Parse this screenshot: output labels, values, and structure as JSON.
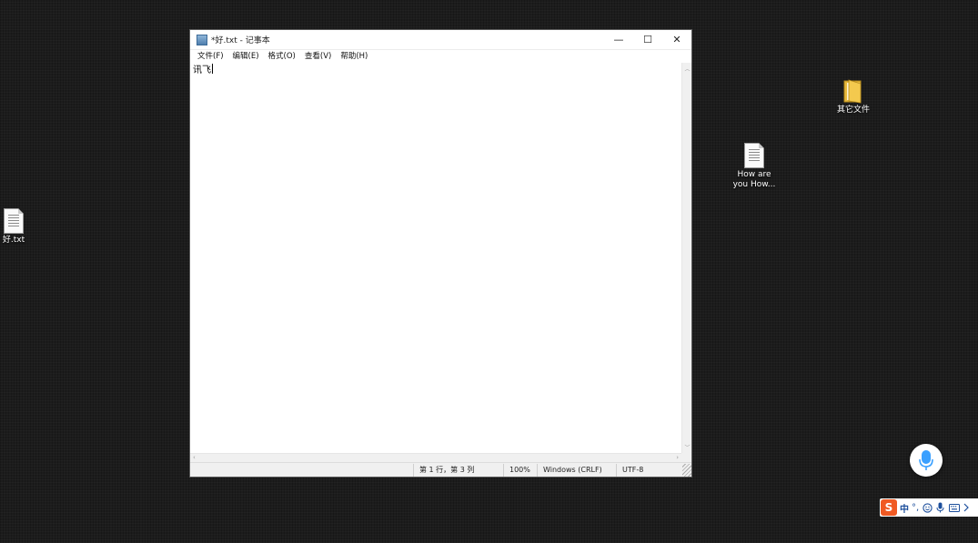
{
  "desktop": {
    "icons": [
      {
        "label": "好.txt",
        "icon": "text-file-icon"
      },
      {
        "label": "其它文件",
        "icon": "folder-icon"
      },
      {
        "label": "How are you How...",
        "icon": "text-file-icon"
      }
    ]
  },
  "notepad": {
    "title": "*好.txt - 记事本",
    "menu": [
      "文件(F)",
      "编辑(E)",
      "格式(O)",
      "查看(V)",
      "帮助(H)"
    ],
    "content": "讯飞",
    "status": {
      "position": "第 1 行，第 3 列",
      "zoom": "100%",
      "line_ending": "Windows (CRLF)",
      "encoding": "UTF-8"
    },
    "controls": {
      "minimize": "—",
      "maximize": "☐",
      "close": "✕"
    }
  },
  "ime": {
    "logo": "S",
    "mode": "中",
    "punct": "°,"
  },
  "colors": {
    "desktop": "#1c1c1c",
    "ime_brand": "#f05a23",
    "mic_blue": "#3aa0ff"
  }
}
